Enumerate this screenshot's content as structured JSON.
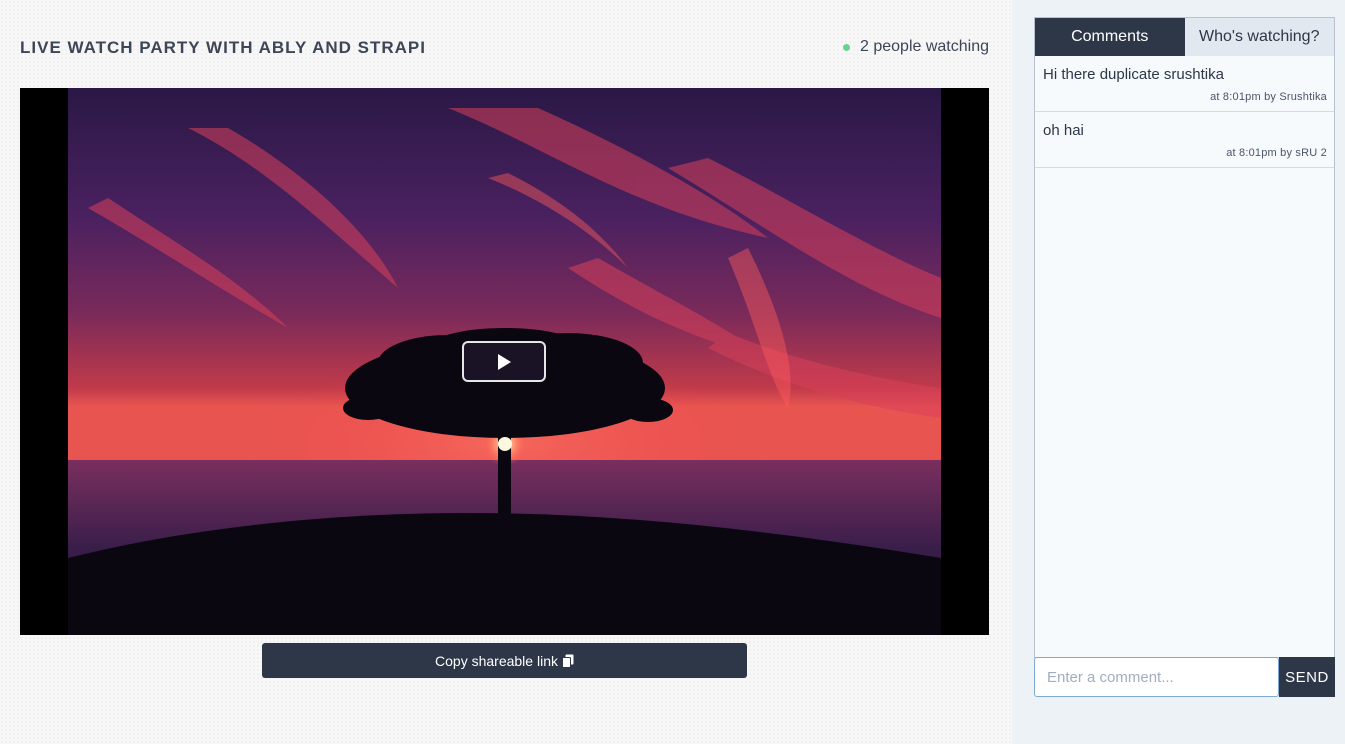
{
  "header": {
    "title": "LIVE WATCH PARTY WITH ABLY AND STRAPI",
    "watching_text": "2 people watching",
    "status_color": "#68d391"
  },
  "video": {
    "play_icon": "play-icon"
  },
  "actions": {
    "copy_label": "Copy shareable link",
    "copy_icon": "clipboard-icon"
  },
  "sidebar": {
    "tabs": [
      {
        "label": "Comments",
        "active": true
      },
      {
        "label": "Who's watching?",
        "active": false
      }
    ],
    "comments": [
      {
        "text": "Hi there duplicate srushtika",
        "meta": "at 8:01pm by Srushtika"
      },
      {
        "text": "oh hai",
        "meta": "at 8:01pm by sRU 2"
      }
    ],
    "input": {
      "placeholder": "Enter a comment...",
      "value": ""
    },
    "send_label": "SEND"
  },
  "colors": {
    "accent": "#2d3748",
    "sidebar_bg": "#edf2f7"
  }
}
